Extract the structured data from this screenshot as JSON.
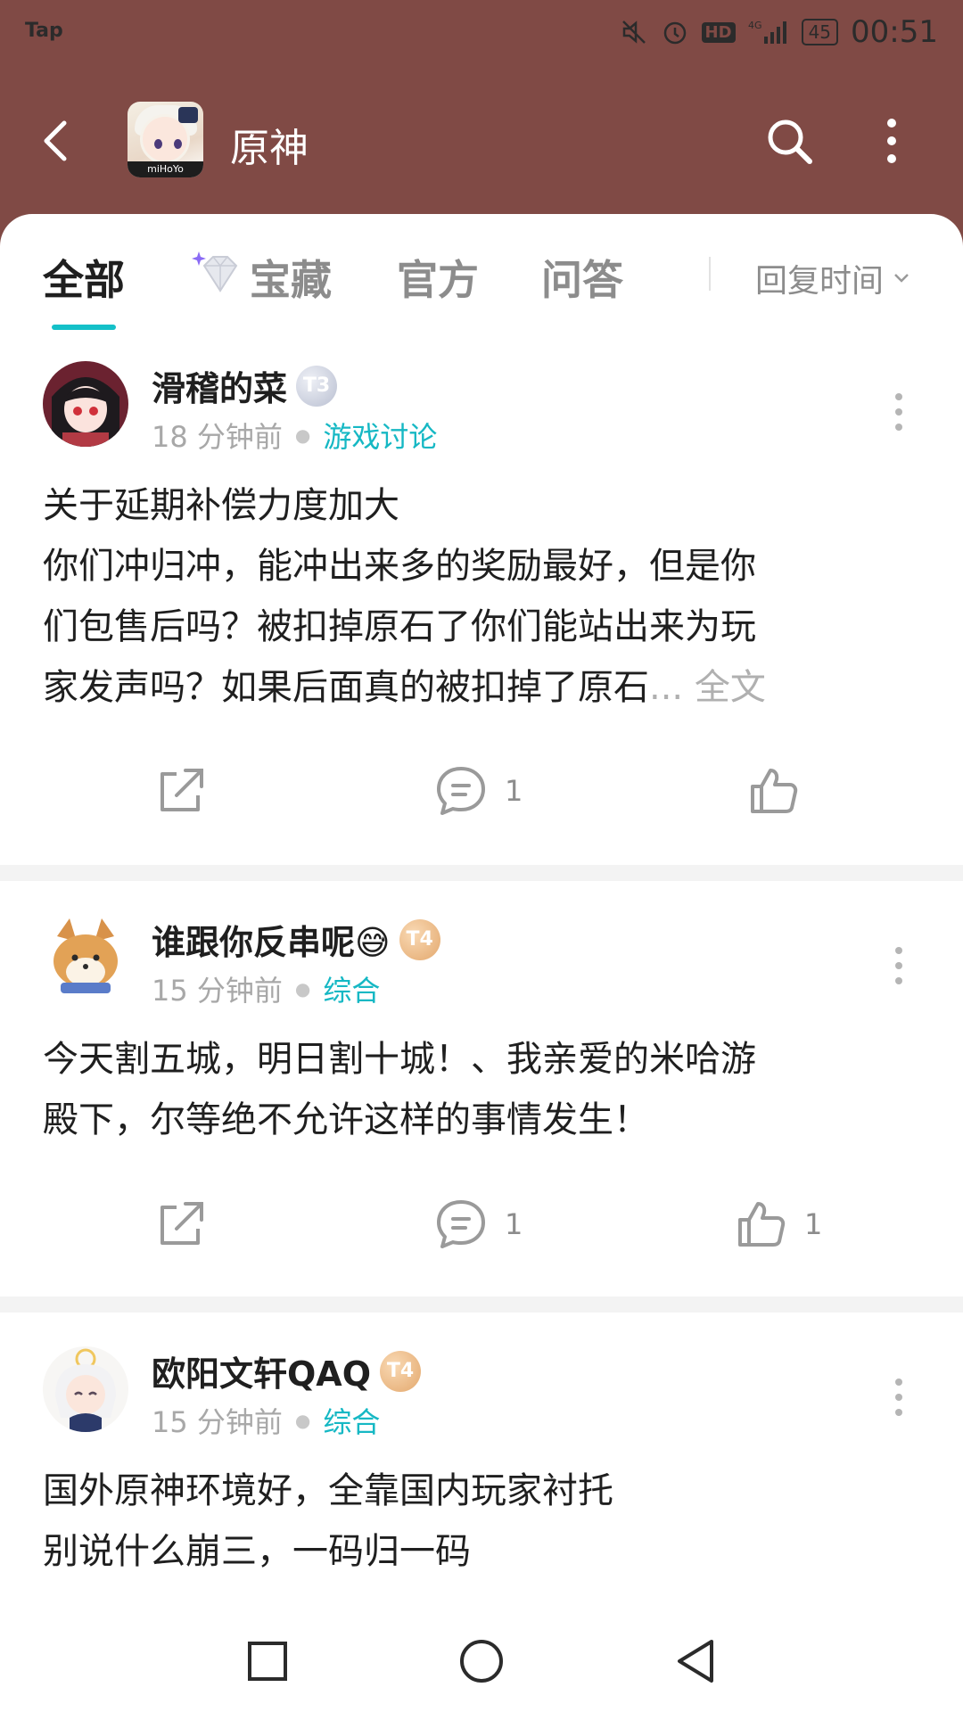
{
  "status_bar": {
    "left_label": "Tap",
    "battery": "45",
    "network": "4G",
    "hd": "HD",
    "time": "00:51"
  },
  "header": {
    "title": "原神",
    "app_icon_brand": "miHoYo"
  },
  "tabs": [
    {
      "label": "全部",
      "active": true
    },
    {
      "label": "宝藏",
      "active": false
    },
    {
      "label": "官方",
      "active": false
    },
    {
      "label": "问答",
      "active": false
    }
  ],
  "sort": {
    "label": "回复时间"
  },
  "posts": [
    {
      "username": "滑稽的菜",
      "badge": "T3",
      "time": "18 分钟前",
      "category": "游戏讨论",
      "lines": [
        "关于延期补偿力度加大",
        "你们冲归冲，能冲出来多的奖励最好，但是你",
        "们包售后吗？被扣掉原石了你们能站出来为玩",
        "家发声吗？如果后面真的被扣掉了原石"
      ],
      "ellipsis": "... ",
      "more_label": "全文",
      "comments": "1",
      "likes": ""
    },
    {
      "username": "谁跟你反串呢😅",
      "badge": "T4",
      "time": "15 分钟前",
      "category": "综合",
      "lines": [
        "今天割五城，明日割十城！、我亲爱的米哈游",
        "殿下，尔等绝不允许这样的事情发生！"
      ],
      "comments": "1",
      "likes": "1"
    },
    {
      "username": "欧阳文轩QAQ",
      "badge": "T4",
      "time": "15 分钟前",
      "category": "综合",
      "lines": [
        "国外原神环境好，全靠国内玩家衬托",
        "别说什么崩三，一码归一码"
      ]
    }
  ]
}
